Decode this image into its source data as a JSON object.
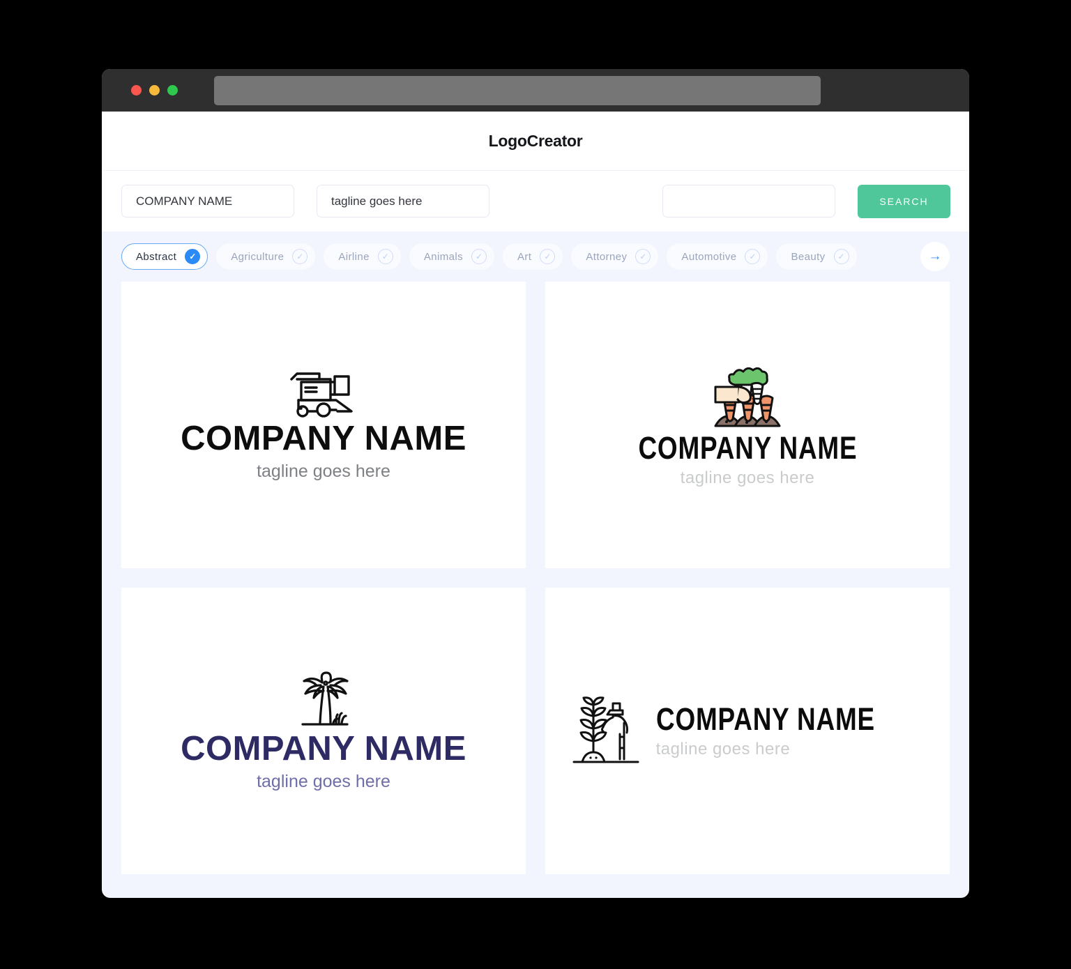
{
  "browser": {
    "traffic_lights": [
      "close",
      "minimize",
      "maximize"
    ],
    "url_value": ""
  },
  "header": {
    "title": "LogoCreator"
  },
  "search": {
    "company_value": "COMPANY NAME",
    "company_placeholder": "COMPANY NAME",
    "tagline_value": "tagline goes here",
    "tagline_placeholder": "tagline goes here",
    "keyword_value": "",
    "keyword_placeholder": "",
    "button_label": "SEARCH",
    "button_color": "#4fc79b"
  },
  "categories": {
    "next_icon": "arrow-right-icon",
    "items": [
      {
        "label": "Abstract",
        "selected": true
      },
      {
        "label": "Agriculture",
        "selected": false
      },
      {
        "label": "Airline",
        "selected": false
      },
      {
        "label": "Animals",
        "selected": false
      },
      {
        "label": "Art",
        "selected": false
      },
      {
        "label": "Attorney",
        "selected": false
      },
      {
        "label": "Automotive",
        "selected": false
      },
      {
        "label": "Beauty",
        "selected": false
      }
    ],
    "tick_icon": "check-icon",
    "active_color": "#2b8af5"
  },
  "results": [
    {
      "icon": "combine-harvester-icon",
      "name": "COMPANY NAME",
      "tagline": "tagline goes here",
      "name_color": "#0d0d0d",
      "tagline_color": "#7d8085",
      "layout": "vertical"
    },
    {
      "icon": "hand-picking-carrots-icon",
      "name": "COMPANY NAME",
      "tagline": "tagline goes here",
      "name_color": "#0b0b0b",
      "tagline_color": "#c9cbcd",
      "layout": "vertical",
      "icon_colors": {
        "carrot": "#f0956b",
        "leaves": "#6cc46c",
        "soil": "#8a7268",
        "sleeve": "#fbe7cd"
      }
    },
    {
      "icon": "palm-tree-icon",
      "name": "COMPANY NAME",
      "tagline": "tagline goes here",
      "name_color": "#2e2a63",
      "tagline_color": "#6f6ea8",
      "layout": "vertical"
    },
    {
      "icon": "farmer-with-plant-icon",
      "name": "COMPANY NAME",
      "tagline": "tagline goes here",
      "name_color": "#0b0b0b",
      "tagline_color": "#c9cbcd",
      "layout": "horizontal"
    }
  ]
}
